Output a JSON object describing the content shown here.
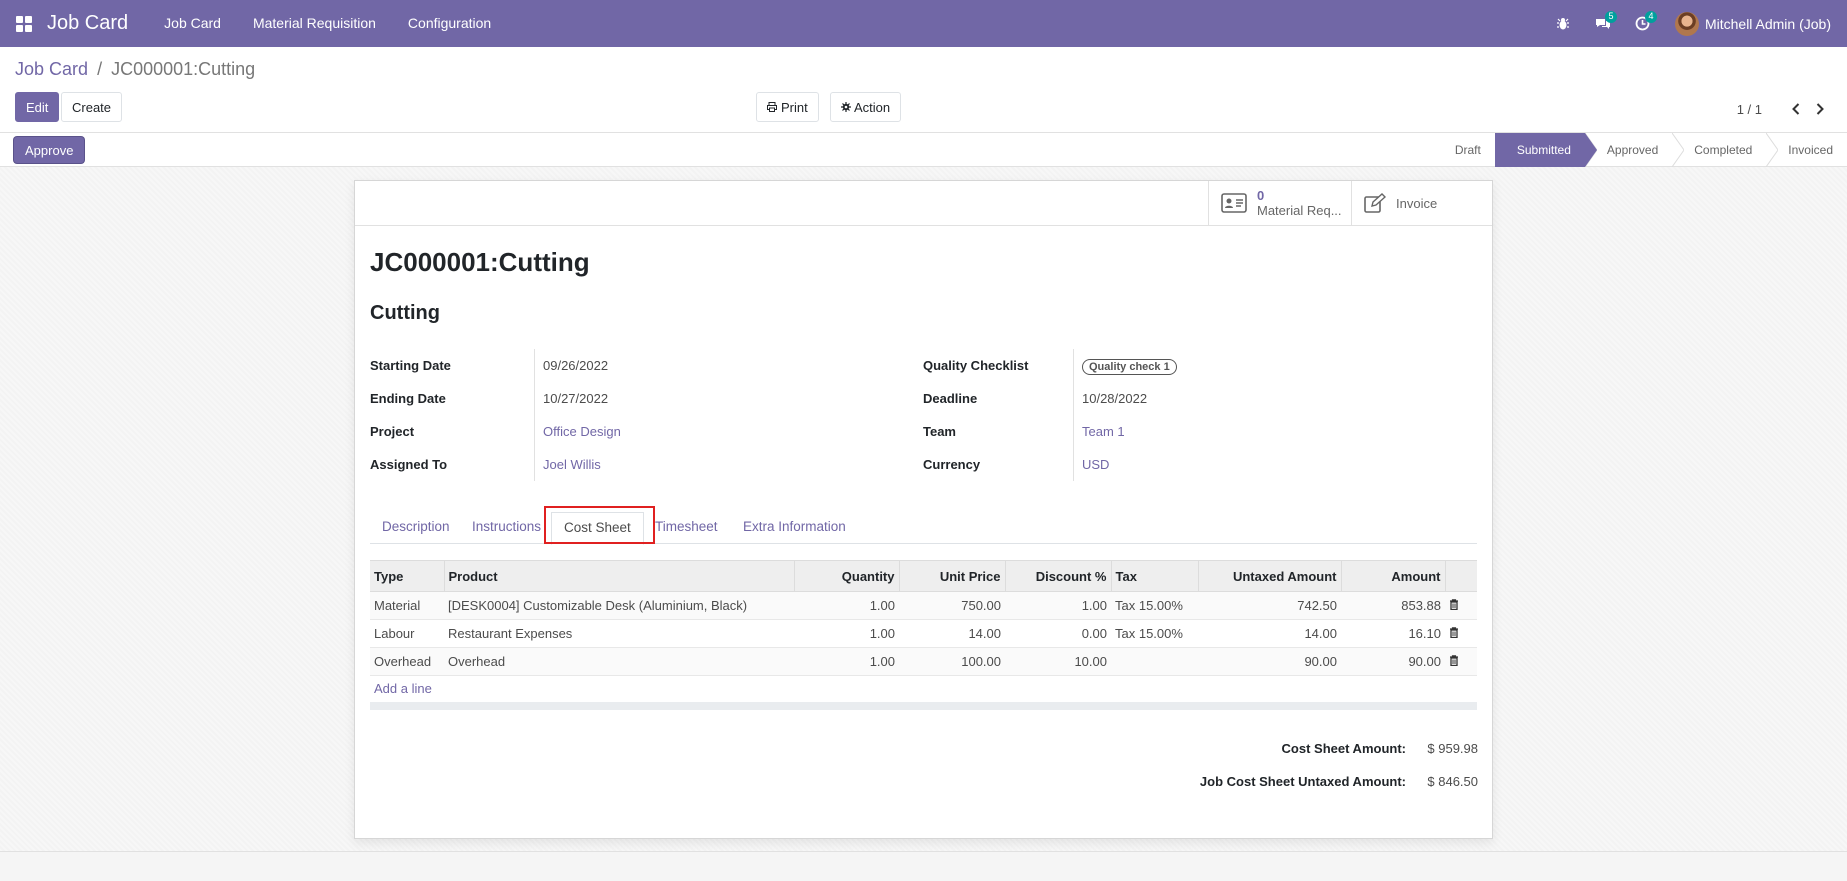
{
  "navbar": {
    "brand": "Job Card",
    "menu": [
      "Job Card",
      "Material Requisition",
      "Configuration"
    ],
    "messages_badge": "5",
    "activity_badge": "4",
    "user_name": "Mitchell Admin (Job)"
  },
  "breadcrumb": {
    "parent": "Job Card",
    "separator": "/",
    "current": "JC000001:Cutting"
  },
  "toolbar": {
    "edit_label": "Edit",
    "create_label": "Create",
    "print_label": "Print",
    "action_label": "Action"
  },
  "pager": {
    "value": "1 / 1"
  },
  "statusbar": {
    "approve_label": "Approve",
    "stages": [
      "Draft",
      "Submitted",
      "Approved",
      "Completed",
      "Invoiced"
    ],
    "active_stage": "Submitted"
  },
  "smart_buttons": {
    "material_count": "0",
    "material_label": "Material Req...",
    "invoice_label": "Invoice"
  },
  "form": {
    "title": "JC000001:Cutting",
    "subtitle": "Cutting",
    "left_fields": [
      {
        "label": "Starting Date",
        "value": "09/26/2022"
      },
      {
        "label": "Ending Date",
        "value": "10/27/2022"
      },
      {
        "label": "Project",
        "value": "Office Design"
      },
      {
        "label": "Assigned To",
        "value": "Joel Willis"
      }
    ],
    "right_fields": [
      {
        "label": "Quality Checklist",
        "value": "Quality check 1"
      },
      {
        "label": "Deadline",
        "value": "10/28/2022"
      },
      {
        "label": "Team",
        "value": "Team 1"
      },
      {
        "label": "Currency",
        "value": "USD"
      }
    ]
  },
  "tabs": [
    "Description",
    "Instructions",
    "Cost Sheet",
    "Timesheet",
    "Extra Information"
  ],
  "active_tab": "Cost Sheet",
  "cost_table": {
    "headers": [
      "Type",
      "Product",
      "Quantity",
      "Unit Price",
      "Discount %",
      "Tax",
      "Untaxed Amount",
      "Amount"
    ],
    "rows": [
      {
        "type": "Material",
        "product": "[DESK0004] Customizable Desk (Aluminium, Black)",
        "quantity": "1.00",
        "unit_price": "750.00",
        "discount": "1.00",
        "tax": "Tax 15.00%",
        "untaxed": "742.50",
        "amount": "853.88"
      },
      {
        "type": "Labour",
        "product": "Restaurant Expenses",
        "quantity": "1.00",
        "unit_price": "14.00",
        "discount": "0.00",
        "tax": "Tax 15.00%",
        "untaxed": "14.00",
        "amount": "16.10"
      },
      {
        "type": "Overhead",
        "product": "Overhead",
        "quantity": "1.00",
        "unit_price": "100.00",
        "discount": "10.00",
        "tax": "",
        "untaxed": "90.00",
        "amount": "90.00"
      }
    ],
    "add_line_label": "Add a line"
  },
  "totals": {
    "cost_sheet_label": "Cost Sheet Amount:",
    "cost_sheet_value": "$ 959.98",
    "untaxed_label": "Job Cost Sheet Untaxed Amount:",
    "untaxed_value": "$ 846.50"
  },
  "colors": {
    "brand": "#7167a6",
    "highlight": "#e02020"
  }
}
